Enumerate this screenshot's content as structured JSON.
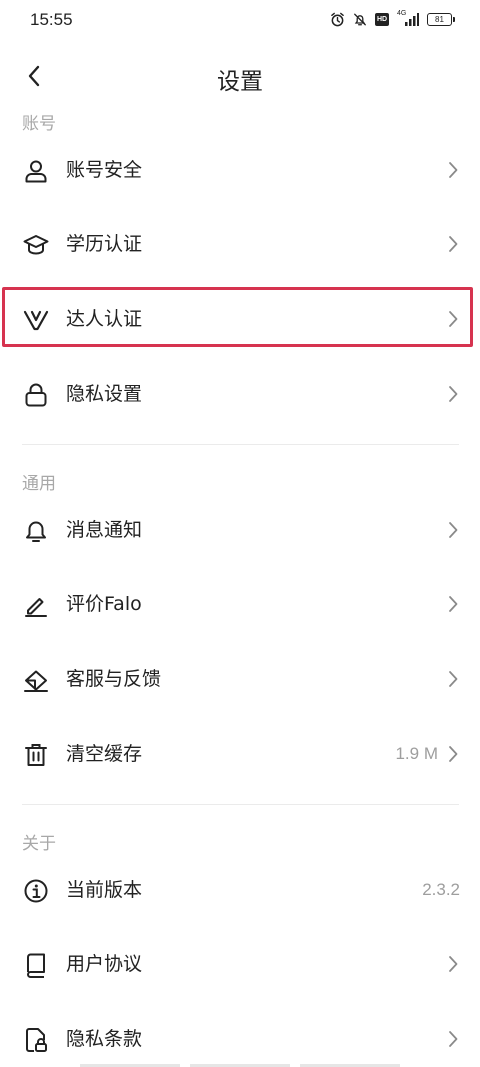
{
  "status_bar": {
    "time": "15:55",
    "network": "4G",
    "battery": "81"
  },
  "nav": {
    "title": "设置"
  },
  "sections": {
    "account": {
      "header": "账号",
      "items": [
        {
          "label": "账号安全",
          "icon": "user-icon"
        },
        {
          "label": "学历认证",
          "icon": "graduation-cap-icon"
        },
        {
          "label": "达人认证",
          "icon": "v-badge-icon",
          "highlighted": true
        },
        {
          "label": "隐私设置",
          "icon": "lock-icon"
        }
      ]
    },
    "general": {
      "header": "通用",
      "items": [
        {
          "label": "消息通知",
          "icon": "bell-icon"
        },
        {
          "label": "评价Falo",
          "icon": "pen-icon"
        },
        {
          "label": "客服与反馈",
          "icon": "feedback-icon"
        },
        {
          "label": "清空缓存",
          "icon": "trash-icon",
          "value": "1.9 M"
        }
      ]
    },
    "about": {
      "header": "关于",
      "items": [
        {
          "label": "当前版本",
          "icon": "info-icon",
          "value": "2.3.2"
        },
        {
          "label": "用户协议",
          "icon": "book-icon"
        },
        {
          "label": "隐私条款",
          "icon": "document-lock-icon"
        }
      ]
    }
  },
  "colors": {
    "highlight": "#d6334f",
    "section_header": "#a8a8a8",
    "text": "#222222"
  }
}
